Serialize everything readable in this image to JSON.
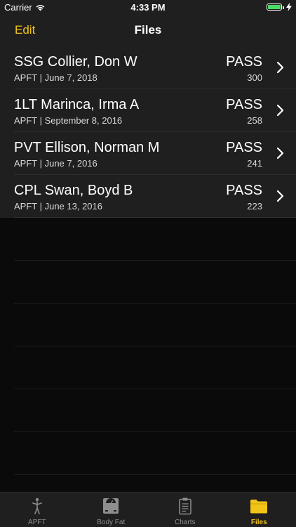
{
  "status_bar": {
    "carrier": "Carrier",
    "time": "4:33 PM",
    "battery_level": 1.0,
    "battery_color": "#4cd964"
  },
  "nav": {
    "edit_label": "Edit",
    "title": "Files"
  },
  "files": [
    {
      "name": "SSG Collier, Don W",
      "subtitle": "APFT | June 7, 2018",
      "result": "PASS",
      "score": "300"
    },
    {
      "name": "1LT Marinca, Irma A",
      "subtitle": "APFT | September 8, 2016",
      "result": "PASS",
      "score": "258"
    },
    {
      "name": "PVT Ellison, Norman M",
      "subtitle": "APFT | June 7, 2016",
      "result": "PASS",
      "score": "241"
    },
    {
      "name": "CPL Swan, Boyd B",
      "subtitle": "APFT | June 13, 2016",
      "result": "PASS",
      "score": "223"
    }
  ],
  "tabs": [
    {
      "label": "APFT",
      "icon": "runner-icon",
      "active": false
    },
    {
      "label": "Body Fat",
      "icon": "scale-icon",
      "active": false
    },
    {
      "label": "Charts",
      "icon": "clipboard-icon",
      "active": false
    },
    {
      "label": "Files",
      "icon": "folder-icon",
      "active": true
    }
  ],
  "colors": {
    "accent": "#f2c418",
    "background": "#0a0a0a",
    "bar": "#1f1f1f"
  }
}
